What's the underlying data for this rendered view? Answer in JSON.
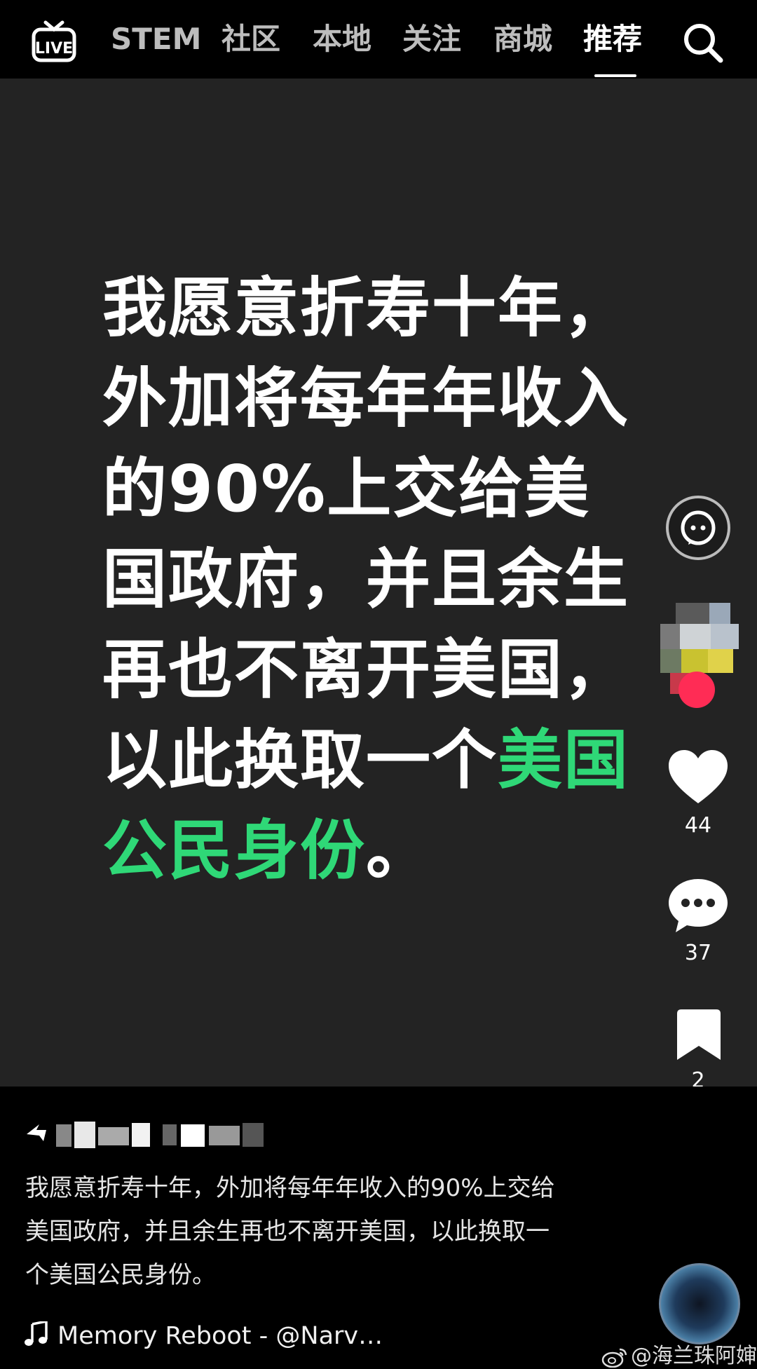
{
  "top_nav": {
    "tabs": [
      {
        "label": "STEM"
      },
      {
        "label": "社区"
      },
      {
        "label": "本地"
      },
      {
        "label": "关注"
      },
      {
        "label": "商城"
      },
      {
        "label": "推荐",
        "active": true
      }
    ],
    "icons": [
      "live-icon",
      "search-icon"
    ]
  },
  "video": {
    "text_white_1": "我愿意折寿十年，外加将每年年收入的90%上交给美国政府，并且余生再也不离开美国，以此换取一个",
    "text_green": "美国公民身份",
    "text_white_2": "。",
    "highlight_color": "#2fd877"
  },
  "actions": {
    "like_count": "44",
    "comment_count": "37",
    "favorite_count": "2",
    "icons": [
      "chat-ai-icon",
      "heart-icon",
      "comment-icon",
      "bookmark-icon",
      "share-icon"
    ]
  },
  "post": {
    "description": "我愿意折寿十年，外加将每年年收入的90%上交给美国政府，并且余生再也不离开美国，以此换取一个美国公民身份。",
    "music": "Memory Reboot - @Narv…"
  },
  "watermark": "@海兰珠阿婶"
}
